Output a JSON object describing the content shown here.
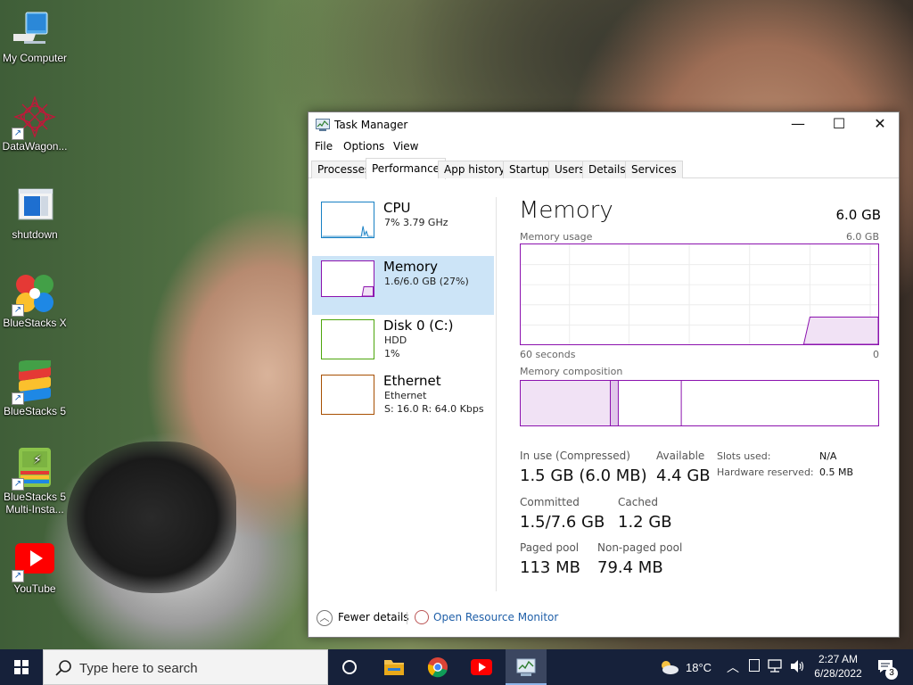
{
  "desktop": {
    "icons": [
      {
        "label": "My Computer"
      },
      {
        "label": "DataWagon..."
      },
      {
        "label": "shutdown"
      },
      {
        "label": "BlueStacks X"
      },
      {
        "label": "BlueStacks 5"
      },
      {
        "label": "BlueStacks 5 Multi-Insta..."
      },
      {
        "label": "YouTube"
      }
    ]
  },
  "window": {
    "title": "Task Manager",
    "controls": {
      "minimize": "—",
      "maximize": "☐",
      "close": "✕"
    },
    "menu": [
      "File",
      "Options",
      "View"
    ],
    "tabs": [
      "Processes",
      "Performance",
      "App history",
      "Startup",
      "Users",
      "Details",
      "Services"
    ],
    "active_tab": "Performance"
  },
  "sidebar": {
    "items": [
      {
        "name": "CPU",
        "line1": "7% 3.79 GHz",
        "color": "#1780c4"
      },
      {
        "name": "Memory",
        "line1": "1.6/6.0 GB (27%)",
        "color": "#8b12ae",
        "selected": true
      },
      {
        "name": "Disk 0 (C:)",
        "line1": "HDD",
        "line2": "1%",
        "color": "#4da60c"
      },
      {
        "name": "Ethernet",
        "line1": "Ethernet",
        "line2": "S: 16.0  R: 64.0 Kbps",
        "color": "#a74f01"
      }
    ]
  },
  "memory": {
    "title": "Memory",
    "total": "6.0 GB",
    "usage_label": "Memory usage",
    "usage_max": "6.0 GB",
    "time_left": "60 seconds",
    "time_right": "0",
    "composition_label": "Memory composition",
    "usage_fraction": 0.27,
    "stats": {
      "in_use_label": "In use (Compressed)",
      "in_use_value": "1.5 GB (6.0 MB)",
      "available_label": "Available",
      "available_value": "4.4 GB",
      "committed_label": "Committed",
      "committed_value": "1.5/7.6 GB",
      "cached_label": "Cached",
      "cached_value": "1.2 GB",
      "paged_label": "Paged pool",
      "paged_value": "113 MB",
      "nonpaged_label": "Non-paged pool",
      "nonpaged_value": "79.4 MB",
      "slots_label": "Slots used:",
      "slots_value": "N/A",
      "hw_label": "Hardware reserved:",
      "hw_value": "0.5 MB"
    }
  },
  "footer": {
    "fewer_details": "Fewer details",
    "open_rm": "Open Resource Monitor"
  },
  "taskbar": {
    "search_placeholder": "Type here to search",
    "weather": "18°C",
    "time": "2:27 AM",
    "date": "6/28/2022",
    "notifications": "3"
  }
}
